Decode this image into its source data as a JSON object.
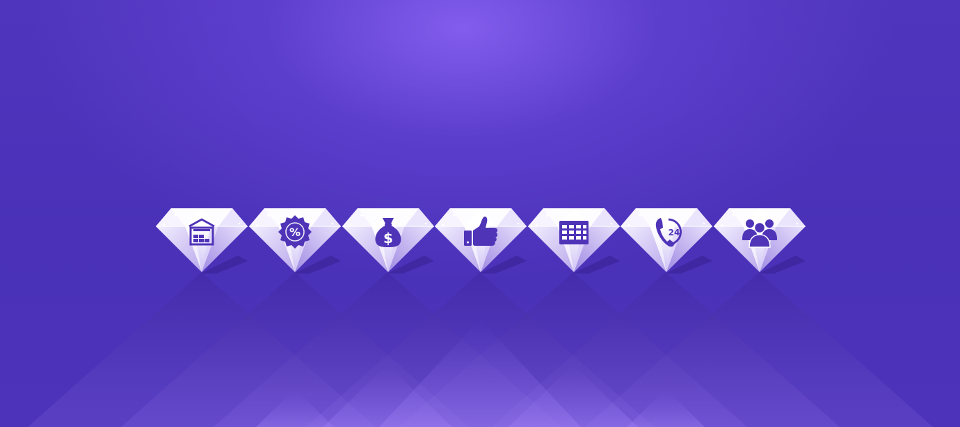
{
  "scene": {
    "background_color": "#4a2fb6",
    "glow_color": "#8c64f5",
    "gem_color": "#ffffff",
    "icon_color": "#4f34b8"
  },
  "gems": [
    {
      "name": "gem-warehouse",
      "icon": "warehouse-icon"
    },
    {
      "name": "gem-discount",
      "icon": "discount-badge-icon"
    },
    {
      "name": "gem-money-bag",
      "icon": "money-bag-icon",
      "text": "$"
    },
    {
      "name": "gem-like",
      "icon": "thumbs-up-icon"
    },
    {
      "name": "gem-grid",
      "icon": "table-grid-icon"
    },
    {
      "name": "gem-support",
      "icon": "phone-24-icon",
      "text": "24"
    },
    {
      "name": "gem-team",
      "icon": "team-icon"
    }
  ],
  "labels": {
    "percent": "%",
    "dollar": "$",
    "support_hours": "24"
  }
}
